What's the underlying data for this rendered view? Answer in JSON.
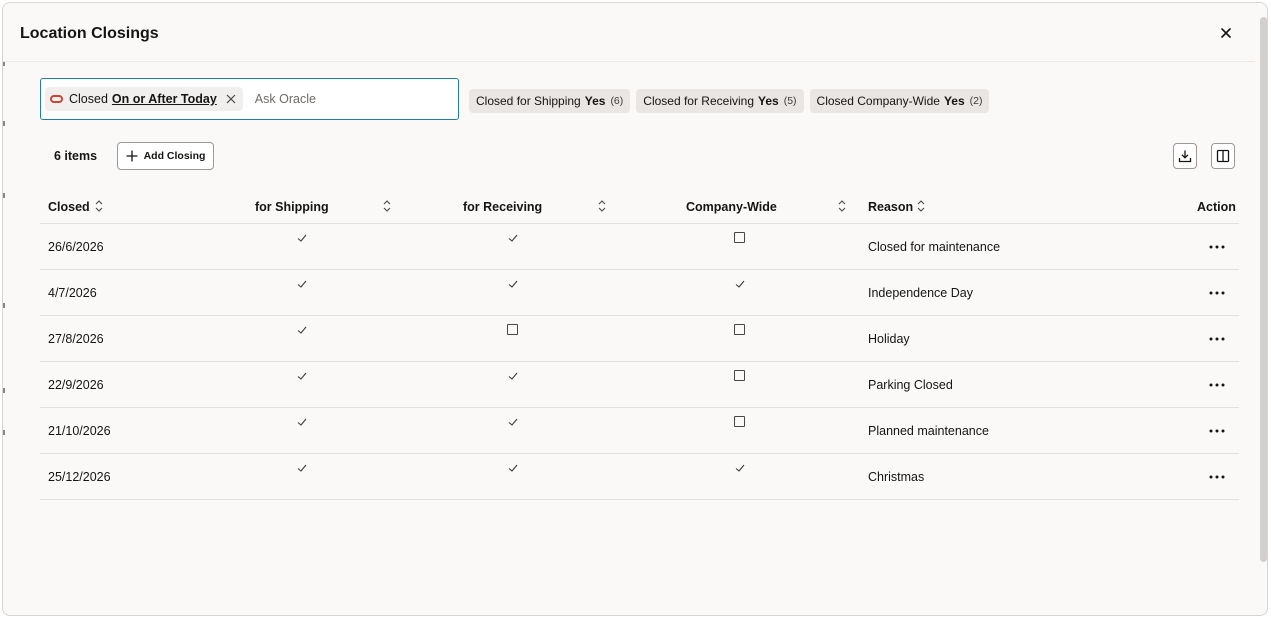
{
  "dialog": {
    "title": "Location Closings",
    "close_icon": "close-icon"
  },
  "search": {
    "chip": {
      "label": "Closed",
      "value": "On or After Today"
    },
    "placeholder": "Ask Oracle"
  },
  "suggestions": [
    {
      "label": "Closed for Shipping",
      "value": "Yes",
      "count": "(6)"
    },
    {
      "label": "Closed for Receiving",
      "value": "Yes",
      "count": "(5)"
    },
    {
      "label": "Closed Company-Wide",
      "value": "Yes",
      "count": "(2)"
    }
  ],
  "toolbar": {
    "items_count": "6 items",
    "add_label": "Add Closing"
  },
  "table": {
    "headers": {
      "closed": "Closed",
      "shipping": "for Shipping",
      "receiving": "for Receiving",
      "company": "Company-Wide",
      "reason": "Reason",
      "action": "Action"
    },
    "rows": [
      {
        "closed": "26/6/2026",
        "shipping": true,
        "receiving": true,
        "company": false,
        "reason": "Closed for maintenance"
      },
      {
        "closed": "4/7/2026",
        "shipping": true,
        "receiving": true,
        "company": true,
        "reason": "Independence Day"
      },
      {
        "closed": "27/8/2026",
        "shipping": true,
        "receiving": false,
        "company": false,
        "reason": "Holiday"
      },
      {
        "closed": "22/9/2026",
        "shipping": true,
        "receiving": true,
        "company": false,
        "reason": "Parking Closed"
      },
      {
        "closed": "21/10/2026",
        "shipping": true,
        "receiving": true,
        "company": false,
        "reason": "Planned maintenance"
      },
      {
        "closed": "25/12/2026",
        "shipping": true,
        "receiving": true,
        "company": true,
        "reason": "Christmas"
      }
    ]
  },
  "colors": {
    "accent": "#227e9e",
    "brand": "#c74634",
    "panel": "#fbf9f8"
  }
}
